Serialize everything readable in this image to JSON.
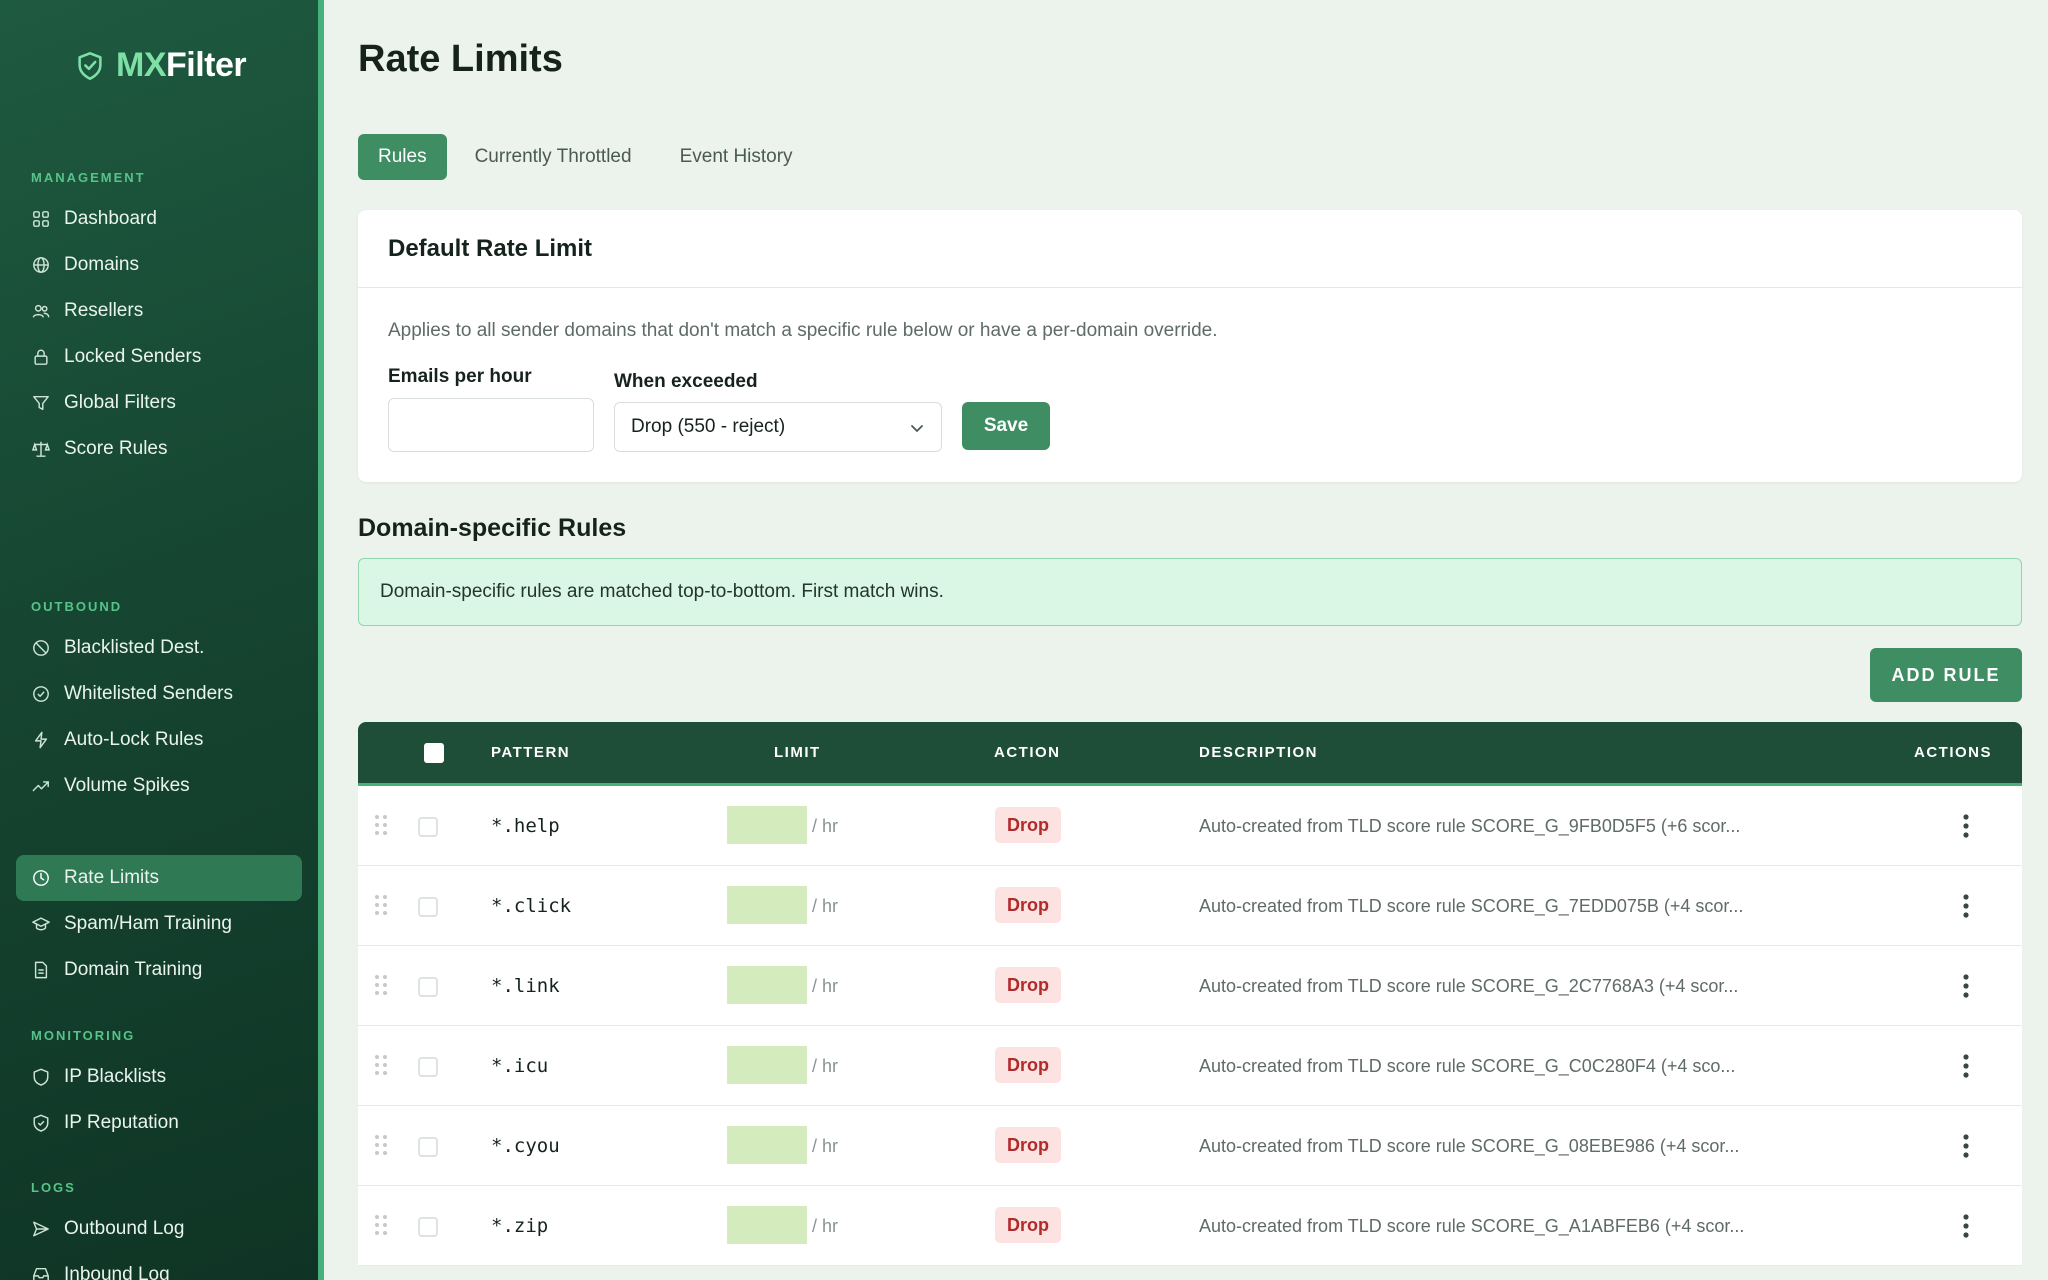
{
  "brand": {
    "accent": "MX",
    "rest": "Filter"
  },
  "sidebar": {
    "sections": [
      {
        "label": "MANAGEMENT",
        "items": [
          {
            "label": "Dashboard",
            "icon": "grid-icon"
          },
          {
            "label": "Domains",
            "icon": "globe-icon"
          },
          {
            "label": "Resellers",
            "icon": "users-icon"
          },
          {
            "label": "Locked Senders",
            "icon": "lock-icon"
          },
          {
            "label": "Global Filters",
            "icon": "filter-icon"
          },
          {
            "label": "Score Rules",
            "icon": "scale-icon"
          }
        ]
      },
      {
        "label": "OUTBOUND",
        "items": [
          {
            "label": "Blacklisted Dest.",
            "icon": "ban-icon"
          },
          {
            "label": "Whitelisted Senders",
            "icon": "check-circle-icon"
          },
          {
            "label": "Auto-Lock Rules",
            "icon": "bolt-icon"
          },
          {
            "label": "Volume Spikes",
            "icon": "trend-up-icon"
          },
          {
            "label": "Rate Limits",
            "icon": "clock-icon",
            "active": true
          },
          {
            "label": "Spam/Ham Training",
            "icon": "graduation-cap-icon"
          },
          {
            "label": "Domain Training",
            "icon": "document-icon"
          }
        ]
      },
      {
        "label": "MONITORING",
        "items": [
          {
            "label": "IP Blacklists",
            "icon": "shield-icon"
          },
          {
            "label": "IP Reputation",
            "icon": "shield-check-icon"
          }
        ]
      },
      {
        "label": "LOGS",
        "items": [
          {
            "label": "Outbound Log",
            "icon": "send-icon"
          },
          {
            "label": "Inbound Log",
            "icon": "inbox-icon"
          }
        ]
      }
    ]
  },
  "page": {
    "title": "Rate Limits"
  },
  "tabs": [
    {
      "label": "Rules",
      "active": true
    },
    {
      "label": "Currently Throttled"
    },
    {
      "label": "Event History"
    }
  ],
  "default_limit": {
    "title": "Default Rate Limit",
    "description": "Applies to all sender domains that don't match a specific rule below or have a per-domain override.",
    "emails_label": "Emails per hour",
    "emails_value": "",
    "exceeded_label": "When exceeded",
    "exceeded_value": "Drop (550 - reject)",
    "save_label": "Save"
  },
  "domain_rules": {
    "title": "Domain-specific Rules",
    "info": "Domain-specific rules are matched top-to-bottom. First match wins.",
    "add_label": "ADD RULE",
    "columns": {
      "pattern": "PATTERN",
      "limit": "LIMIT",
      "action": "ACTION",
      "description": "DESCRIPTION",
      "actions": "ACTIONS"
    },
    "rows": [
      {
        "pattern": "*.help",
        "per": "/ hr",
        "action": "Drop",
        "description": "Auto-created from TLD score rule SCORE_G_9FB0D5F5 (+6 scor..."
      },
      {
        "pattern": "*.click",
        "per": "/ hr",
        "action": "Drop",
        "description": "Auto-created from TLD score rule SCORE_G_7EDD075B (+4 scor..."
      },
      {
        "pattern": "*.link",
        "per": "/ hr",
        "action": "Drop",
        "description": "Auto-created from TLD score rule SCORE_G_2C7768A3 (+4 scor..."
      },
      {
        "pattern": "*.icu",
        "per": "/ hr",
        "action": "Drop",
        "description": "Auto-created from TLD score rule SCORE_G_C0C280F4 (+4 sco..."
      },
      {
        "pattern": "*.cyou",
        "per": "/ hr",
        "action": "Drop",
        "description": "Auto-created from TLD score rule SCORE_G_08EBE986 (+4 scor..."
      },
      {
        "pattern": "*.zip",
        "per": "/ hr",
        "action": "Drop",
        "description": "Auto-created from TLD score rule SCORE_G_A1ABFEB6 (+4 scor..."
      }
    ]
  },
  "colors": {
    "accent": "#3f8d63",
    "sidebar": "#164632",
    "table_header": "#1e4d38",
    "drop_badge": "#b02a2a"
  }
}
